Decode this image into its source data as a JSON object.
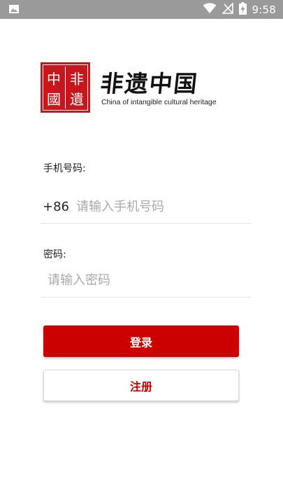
{
  "status_bar": {
    "time": "9:58",
    "icons": [
      "image-icon",
      "wifi-icon",
      "no-signal-icon",
      "battery-charging-icon"
    ]
  },
  "brand": {
    "title": "非遗中国",
    "subtitle": "China of intangible cultural heritage",
    "seal_text": [
      "中",
      "非",
      "國",
      "遺"
    ],
    "seal_color": "#c8161d"
  },
  "form": {
    "phone_label": "手机号码:",
    "country_code": "+86",
    "phone_placeholder": "请输入手机号码",
    "password_label": "密码:",
    "password_placeholder": "请输入密码"
  },
  "actions": {
    "login_label": "登录",
    "register_label": "注册"
  },
  "colors": {
    "primary": "#cc0000",
    "status_bar": "#9a9a9a"
  }
}
